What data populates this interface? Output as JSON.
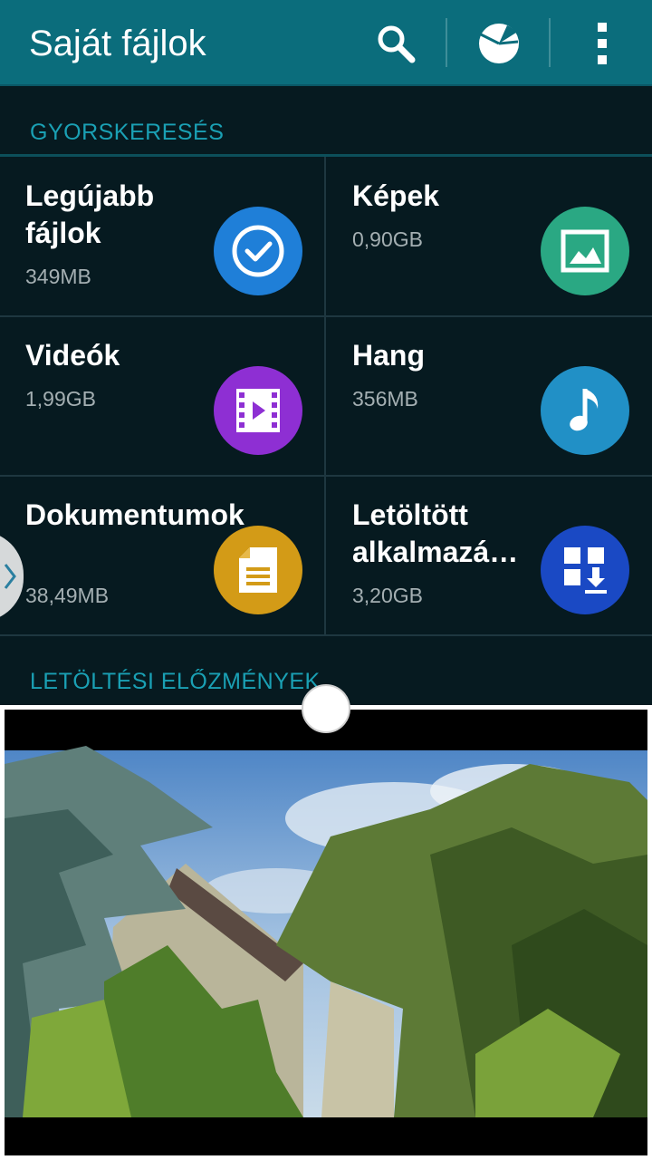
{
  "appbar": {
    "title": "Saját fájlok",
    "icons": [
      "search-icon",
      "storage-pie-icon",
      "more-vert-icon"
    ],
    "color": "#0b6d7c"
  },
  "quick_search": {
    "label": "GYORSKERESÉS",
    "tiles": [
      {
        "name": "Legújabb fájlok",
        "size": "349MB",
        "icon": "clock-check-icon",
        "color": "#1f7fd8"
      },
      {
        "name": "Képek",
        "size": "0,90GB",
        "icon": "image-icon",
        "color": "#2aa883"
      },
      {
        "name": "Videók",
        "size": "1,99GB",
        "icon": "film-icon",
        "color": "#8e2fd3"
      },
      {
        "name": "Hang",
        "size": "356MB",
        "icon": "music-note-icon",
        "color": "#2190c6"
      },
      {
        "name": "Dokumentumok",
        "size": "38,49MB",
        "icon": "document-icon",
        "color": "#d39b17"
      },
      {
        "name": "Letöltött alkalmazá…",
        "size": "3,20GB",
        "icon": "apps-download-icon",
        "color": "#1a49c4"
      }
    ]
  },
  "history": {
    "label": "LETÖLTÉSI ELŐZMÉNYEK"
  },
  "colors": {
    "background": "#061a20",
    "section_label": "#1aa0b4"
  }
}
